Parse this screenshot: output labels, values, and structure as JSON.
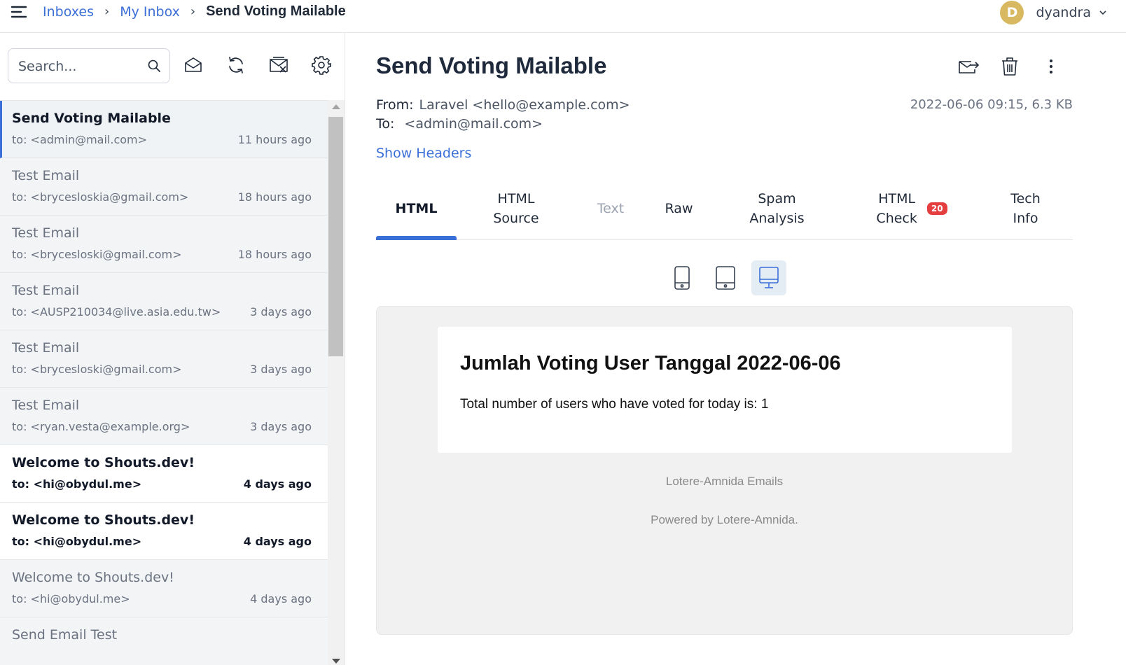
{
  "breadcrumb": {
    "items": [
      "Inboxes",
      "My Inbox"
    ],
    "current": "Send Voting Mailable"
  },
  "user": {
    "initial": "D",
    "name": "dyandra"
  },
  "search": {
    "placeholder": "Search...",
    "value": ""
  },
  "toolbar": {
    "icons": [
      "search-icon",
      "mark-read-icon",
      "refresh-icon",
      "clear-inbox-icon",
      "gear-icon"
    ]
  },
  "messages": [
    {
      "subject": "Send Voting Mailable",
      "to": "to: <admin@mail.com>",
      "time": "11 hours ago",
      "state": "active"
    },
    {
      "subject": "Test Email",
      "to": "to: <brycesloskia@gmail.com>",
      "time": "18 hours ago",
      "state": "read"
    },
    {
      "subject": "Test Email",
      "to": "to: <brycesloski@gmail.com>",
      "time": "18 hours ago",
      "state": "read"
    },
    {
      "subject": "Test Email",
      "to": "to: <AUSP210034@live.asia.edu.tw>",
      "time": "3 days ago",
      "state": "read"
    },
    {
      "subject": "Test Email",
      "to": "to: <brycesloski@gmail.com>",
      "time": "3 days ago",
      "state": "read"
    },
    {
      "subject": "Test Email",
      "to": "to: <ryan.vesta@example.org>",
      "time": "3 days ago",
      "state": "read"
    },
    {
      "subject": "Welcome to Shouts.dev!",
      "to": "to: <hi@obydul.me>",
      "time": "4 days ago",
      "state": "unread"
    },
    {
      "subject": "Welcome to Shouts.dev!",
      "to": "to: <hi@obydul.me>",
      "time": "4 days ago",
      "state": "unread"
    },
    {
      "subject": "Welcome to Shouts.dev!",
      "to": "to: <hi@obydul.me>",
      "time": "4 days ago",
      "state": "read"
    },
    {
      "subject": "Send Email Test",
      "to": "",
      "time": "",
      "state": "read"
    }
  ],
  "message": {
    "title": "Send Voting Mailable",
    "from_label": "From:",
    "from_value": "Laravel <hello@example.com>",
    "to_label": "To:",
    "to_value": "<admin@mail.com>",
    "date_size": "2022-06-06 09:15, 6.3 KB",
    "show_headers": "Show Headers",
    "action_icons": [
      "forward-icon",
      "trash-icon",
      "more-vertical-icon"
    ]
  },
  "tabs": [
    {
      "line1": "HTML",
      "line2": "",
      "state": "active"
    },
    {
      "line1": "HTML",
      "line2": "Source",
      "state": "normal"
    },
    {
      "line1": "Text",
      "line2": "",
      "state": "disabled"
    },
    {
      "line1": "Raw",
      "line2": "",
      "state": "normal"
    },
    {
      "line1": "Spam",
      "line2": "Analysis",
      "state": "normal"
    },
    {
      "line1": "HTML",
      "line2": "Check",
      "state": "normal",
      "badge": "20"
    },
    {
      "line1": "Tech",
      "line2": "Info",
      "state": "normal"
    }
  ],
  "devices": [
    {
      "icon": "phone-icon",
      "active": false
    },
    {
      "icon": "tablet-icon",
      "active": false
    },
    {
      "icon": "desktop-icon",
      "active": true
    }
  ],
  "preview": {
    "heading": "Jumlah Voting User Tanggal 2022-06-06",
    "body": "Total number of users who have voted for today is: 1",
    "footer_name": "Lotere-Amnida Emails",
    "footer_powered": "Powered by Lotere-Amnida."
  },
  "colors": {
    "accent": "#3b6fd8",
    "avatar": "#d8b860",
    "badge": "#e53e3e",
    "text_dark": "#1e293b"
  }
}
